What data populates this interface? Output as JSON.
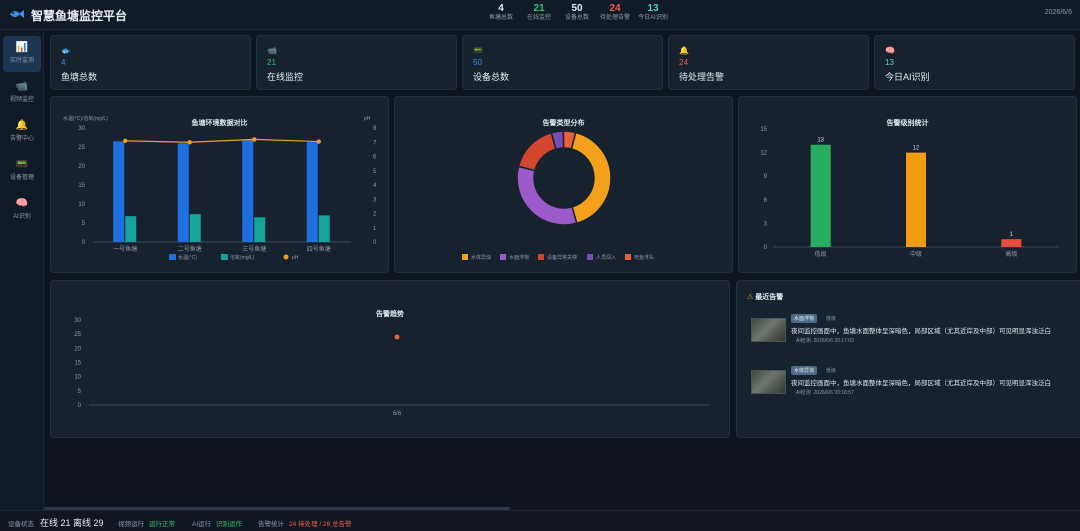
{
  "app": {
    "title": "智慧鱼塘监控平台",
    "date": "2026/6/6"
  },
  "header_stats": [
    {
      "value": "4",
      "label": "鱼塘总数",
      "color": "#e6edf5"
    },
    {
      "value": "21",
      "label": "在线监控",
      "color": "#38c172"
    },
    {
      "value": "50",
      "label": "设备总数",
      "color": "#e6edf5"
    },
    {
      "value": "24",
      "label": "待处理告警",
      "color": "#f05a4f"
    },
    {
      "value": "13",
      "label": "今日AI识别",
      "color": "#4fd1c5"
    }
  ],
  "sidebar": {
    "items": [
      {
        "icon": "chart-icon",
        "glyph": "📊",
        "label": "实时监测"
      },
      {
        "icon": "camera-icon",
        "glyph": "📹",
        "label": "视频监控"
      },
      {
        "icon": "bell-icon",
        "glyph": "🔔",
        "label": "告警中心"
      },
      {
        "icon": "device-icon",
        "glyph": "📟",
        "label": "设备管理"
      },
      {
        "icon": "brain-icon",
        "glyph": "🧠",
        "label": "AI识别"
      }
    ]
  },
  "kpis": [
    {
      "icon": "fish-icon",
      "glyph": "🐟",
      "value": "4",
      "label": "鱼塘总数",
      "color": "#3b8ee8"
    },
    {
      "icon": "camera-icon",
      "glyph": "📹",
      "value": "21",
      "label": "在线监控",
      "color": "#38c172"
    },
    {
      "icon": "device-icon",
      "glyph": "📟",
      "value": "50",
      "label": "设备总数",
      "color": "#3b8ee8"
    },
    {
      "icon": "bell-icon",
      "glyph": "🔔",
      "value": "24",
      "label": "待处理告警",
      "color": "#f05a4f"
    },
    {
      "icon": "brain-icon",
      "glyph": "🧠",
      "value": "13",
      "label": "今日AI识别",
      "color": "#4fd1c5"
    }
  ],
  "chart_data": [
    {
      "type": "bar",
      "title": "鱼塘环境数据对比",
      "ylabel": "水温(°C)/溶氧(mg/L)",
      "y2label": "pH",
      "categories": [
        "一号鱼塘",
        "二号鱼塘",
        "三号鱼塘",
        "四号鱼塘"
      ],
      "ylim": [
        0,
        30
      ],
      "y2lim": [
        0,
        8
      ],
      "series": [
        {
          "name": "水温(°C)",
          "type": "bar",
          "values": [
            26.5,
            26,
            27,
            26.3
          ],
          "color": "#1f6fe0"
        },
        {
          "name": "溶氧(mg/L)",
          "type": "bar",
          "values": [
            6.8,
            7.3,
            6.5,
            7
          ],
          "color": "#16a39b"
        },
        {
          "name": "pH",
          "type": "line",
          "axis": "right",
          "values": [
            7.1,
            7.0,
            7.2,
            7.05
          ],
          "color": "#f0a020"
        }
      ]
    },
    {
      "type": "pie",
      "title": "告警类型分布",
      "labels": [
        "水体异浊",
        "水面浮物",
        "设备异常关停",
        "人员闯入",
        "死鱼浮头"
      ],
      "values": [
        10,
        8,
        4,
        1,
        1
      ],
      "colors": [
        "#f5a01a",
        "#9b5bc9",
        "#d4452e",
        "#7b4bb6",
        "#e8603a"
      ]
    },
    {
      "type": "bar",
      "title": "告警级别统计",
      "categories": [
        "低级",
        "中级",
        "高级"
      ],
      "values": [
        13,
        12,
        1
      ],
      "colors": [
        "#27ae60",
        "#f39c12",
        "#e74c3c"
      ],
      "ylim": [
        0,
        15
      ]
    },
    {
      "type": "scatter",
      "title": "告警趋势",
      "x": [
        "6/6"
      ],
      "values": [
        24
      ],
      "ylim": [
        0,
        30
      ],
      "color": "#e8603a"
    }
  ],
  "recent_alerts": {
    "title": "最近告警",
    "items": [
      {
        "tag": "水面浮物",
        "level": "低级",
        "desc": "夜间监控画面中，鱼塘水面整体呈深暗色，局部区域（尤其近岸及中部）可见明显浑浊泛白",
        "source": "AI检测",
        "time": "2026/6/6 20:17:03"
      },
      {
        "tag": "水体异浊",
        "level": "低级",
        "desc": "夜间监控画面中，鱼塘水面整体呈深暗色，局部区域（尤其近岸及中部）可见明显浑浊泛白",
        "source": "AI检测",
        "time": "2026/6/6 20:16:57"
      }
    ]
  },
  "footer": {
    "device_label": "设备状态",
    "device_value": "在线 21 离线 29",
    "video_label": "视频运行",
    "video_value": "运行正常",
    "ai_label": "AI运行",
    "ai_value": "识别运作",
    "alert_label": "告警统计",
    "alert_value": "24 待处理 / 26 总告警"
  }
}
